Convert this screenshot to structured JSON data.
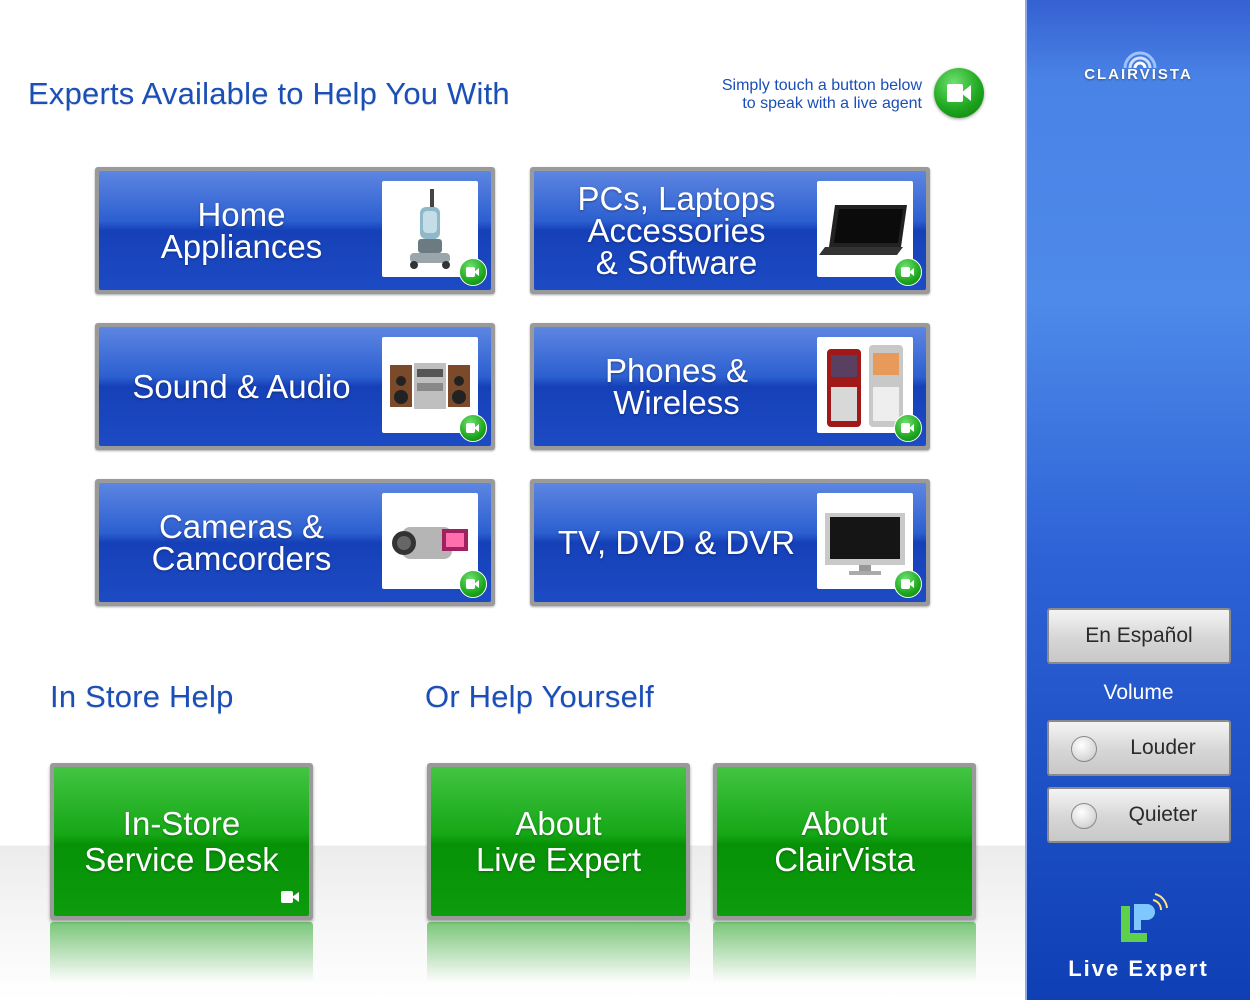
{
  "header": {
    "title": "Experts Available to Help You With",
    "hint_line1": "Simply touch a button below",
    "hint_line2": "to speak with a live agent"
  },
  "categories": [
    {
      "label": "Home\nAppliances",
      "image": "vacuum-cleaner",
      "icon": "video-camera-icon"
    },
    {
      "label": "PCs, Laptops\nAccessories\n& Software",
      "image": "laptop",
      "icon": "video-camera-icon"
    },
    {
      "label": "Sound & Audio",
      "image": "stereo-system",
      "icon": "video-camera-icon"
    },
    {
      "label": "Phones &\nWireless",
      "image": "mobile-phones",
      "icon": "video-camera-icon"
    },
    {
      "label": "Cameras &\nCamcorders",
      "image": "camcorder",
      "icon": "video-camera-icon"
    },
    {
      "label": "TV, DVD & DVR",
      "image": "flat-screen-tv",
      "icon": "video-camera-icon"
    }
  ],
  "sections": {
    "in_store": "In Store Help",
    "self_help": "Or Help Yourself"
  },
  "bottom_buttons": {
    "service_desk": "In-Store\nService Desk",
    "about_live_expert": "About\nLive Expert",
    "about_clairvista": "About\nClairVista"
  },
  "sidebar": {
    "brand": "ClairVista",
    "language_button": "En Español",
    "volume_label": "Volume",
    "louder_button": "Louder",
    "quieter_button": "Quieter",
    "product_name": "Live Expert"
  },
  "colors": {
    "heading_blue": "#1a4fb8",
    "tile_blue": "#1d4bc4",
    "action_green": "#0c9c0c",
    "sidebar_blue": "#2d62d6"
  }
}
